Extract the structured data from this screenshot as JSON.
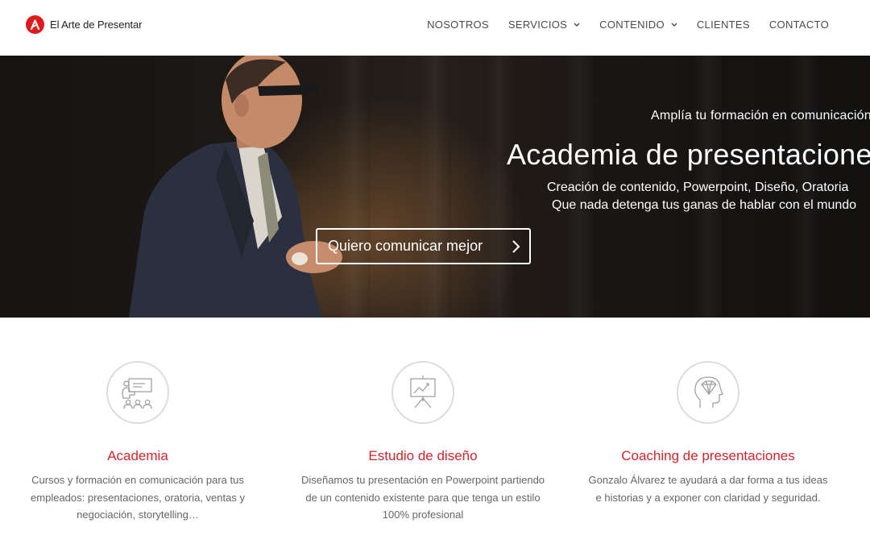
{
  "brand": {
    "name": "El Arte de Presentar",
    "accent_color": "#e0191b"
  },
  "nav": {
    "items": [
      {
        "label": "NOSOTROS",
        "dropdown": false
      },
      {
        "label": "SERVICIOS",
        "dropdown": true
      },
      {
        "label": "CONTENIDO",
        "dropdown": true
      },
      {
        "label": "CLIENTES",
        "dropdown": false
      },
      {
        "label": "CONTACTO",
        "dropdown": false
      }
    ]
  },
  "hero": {
    "overline": "Amplía tu formación en comunicación",
    "title": "Academia de presentaciones",
    "subtitle_lines": [
      "Creación de contenido, Powerpoint, Diseño, Oratoria",
      "Que nada detenga tus ganas de hablar con el mundo"
    ],
    "cta_label": "Quiero comunicar mejor"
  },
  "services": [
    {
      "icon": "classroom-presentation-icon",
      "title": "Academia",
      "description": "Cursos y formación en comunicación para tus empleados: presentaciones, oratoria, ventas y negociación, storytelling…"
    },
    {
      "icon": "chart-easel-icon",
      "title": "Estudio de diseño",
      "description": "Diseñamos tu presentación en Powerpoint partiendo de un contenido existente para que tenga un estilo 100% profesional"
    },
    {
      "icon": "head-diamond-icon",
      "title": "Coaching de presentaciones",
      "description": "Gonzalo Álvarez te ayudará a dar forma a tus ideas e historias y a exponer con claridad y seguridad."
    }
  ],
  "colors": {
    "service_title": "#d3242b",
    "hero_text": "#ffffff",
    "nav_text": "#4b4b4b"
  }
}
